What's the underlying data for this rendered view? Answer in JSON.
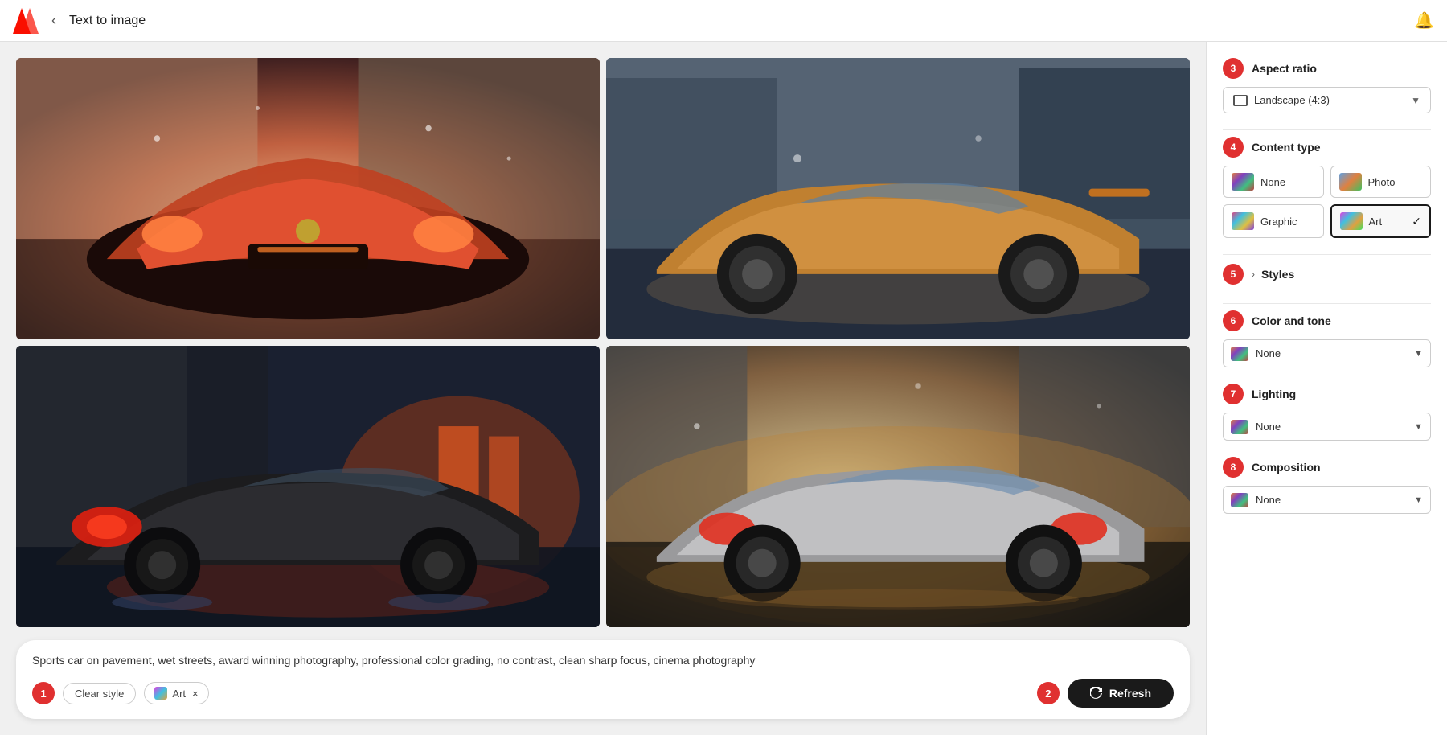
{
  "header": {
    "back_label": "‹",
    "title": "Text to image",
    "notification_icon": "🔔"
  },
  "images": [
    {
      "id": 1,
      "alt": "Red sports car on wet pavement",
      "class": "car-img-1"
    },
    {
      "id": 2,
      "alt": "Bronze sports car on wet street",
      "class": "car-img-2"
    },
    {
      "id": 3,
      "alt": "Dark sports car with red accents",
      "class": "car-img-3"
    },
    {
      "id": 4,
      "alt": "Silver sports car on wet street",
      "class": "car-img-4"
    }
  ],
  "prompt": {
    "text": "Sports car on pavement, wet streets, award winning photography, professional color grading, no contrast, clean sharp focus, cinema photography"
  },
  "footer": {
    "step1_badge": "1",
    "step2_badge": "2",
    "clear_style_label": "Clear style",
    "art_tag_label": "Art",
    "art_tag_x": "×",
    "refresh_label": "Refresh"
  },
  "panel": {
    "step3_badge": "3",
    "step4_badge": "4",
    "step5_badge": "5",
    "step6_badge": "6",
    "step7_badge": "7",
    "step8_badge": "8",
    "aspect_ratio_label": "Aspect ratio",
    "aspect_ratio_value": "Landscape (4:3)",
    "content_type_label": "Content type",
    "content_types": [
      {
        "id": "none",
        "label": "None",
        "selected": false
      },
      {
        "id": "photo",
        "label": "Photo",
        "selected": false
      },
      {
        "id": "graphic",
        "label": "Graphic",
        "selected": false
      },
      {
        "id": "art",
        "label": "Art",
        "selected": true
      }
    ],
    "styles_label": "Styles",
    "color_tone_label": "Color and tone",
    "color_tone_value": "None",
    "lighting_label": "Lighting",
    "lighting_value": "None",
    "composition_label": "Composition",
    "composition_value": "None"
  }
}
